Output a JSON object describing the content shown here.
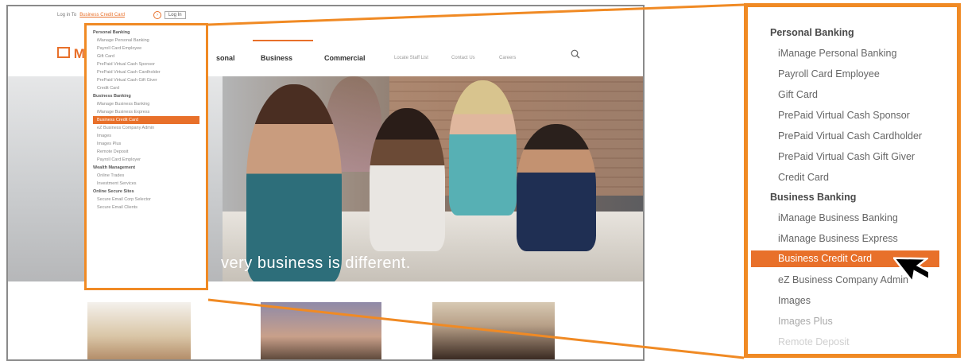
{
  "site": {
    "topbar": {
      "prefix": "Log in To",
      "link": "Business Credit Card",
      "login_button": "Log In"
    },
    "logo_text": "M",
    "nav": {
      "personal_fragment": "sonal",
      "business": "Business",
      "commercial": "Commercial",
      "sub1": "Locate Staff List",
      "sub2": "Contact Us",
      "sub3": "Careers"
    },
    "hero_text": "very business is different.",
    "dropdown": [
      {
        "type": "head",
        "label": "Personal Banking"
      },
      {
        "type": "item",
        "label": "iManage Personal Banking"
      },
      {
        "type": "item",
        "label": "Payroll Card Employee"
      },
      {
        "type": "item",
        "label": "Gift Card"
      },
      {
        "type": "item",
        "label": "PrePaid Virtual Cash Sponsor"
      },
      {
        "type": "item",
        "label": "PrePaid Virtual Cash Cardholder"
      },
      {
        "type": "item",
        "label": "PrePaid Virtual Cash Gift Giver"
      },
      {
        "type": "item",
        "label": "Credit Card"
      },
      {
        "type": "head",
        "label": "Business Banking"
      },
      {
        "type": "item",
        "label": "iManage Business Banking"
      },
      {
        "type": "item",
        "label": "iManage Business Express"
      },
      {
        "type": "active",
        "label": "Business Credit Card"
      },
      {
        "type": "item",
        "label": "eZ Business Company Admin"
      },
      {
        "type": "item",
        "label": "Images"
      },
      {
        "type": "item",
        "label": "Images Plus"
      },
      {
        "type": "item",
        "label": "Remote Deposit"
      },
      {
        "type": "item",
        "label": "Payroll Card Employer"
      },
      {
        "type": "head",
        "label": "Wealth Management"
      },
      {
        "type": "item",
        "label": "Online Trades"
      },
      {
        "type": "item",
        "label": "Investment Services"
      },
      {
        "type": "head",
        "label": "Online Secure Sites"
      },
      {
        "type": "item",
        "label": "Secure Email Corp Selector"
      },
      {
        "type": "item",
        "label": "Secure Email Clients"
      }
    ]
  },
  "zoom": {
    "items": [
      {
        "type": "head",
        "label": "Personal Banking"
      },
      {
        "type": "item",
        "label": "iManage Personal Banking"
      },
      {
        "type": "item",
        "label": "Payroll Card Employee"
      },
      {
        "type": "item",
        "label": "Gift Card"
      },
      {
        "type": "item",
        "label": "PrePaid Virtual Cash Sponsor"
      },
      {
        "type": "item",
        "label": "PrePaid Virtual Cash Cardholder"
      },
      {
        "type": "item",
        "label": "PrePaid Virtual Cash Gift Giver"
      },
      {
        "type": "item",
        "label": "Credit Card"
      },
      {
        "type": "head",
        "label": "Business Banking"
      },
      {
        "type": "item",
        "label": "iManage Business Banking"
      },
      {
        "type": "item",
        "label": "iManage Business Express"
      },
      {
        "type": "active",
        "label": "Business Credit Card"
      },
      {
        "type": "item",
        "label": "eZ Business Company Admin"
      },
      {
        "type": "item",
        "label": "Images"
      },
      {
        "type": "faded",
        "label": "Images Plus"
      },
      {
        "type": "faded2",
        "label": "Remote Deposit"
      }
    ]
  },
  "colors": {
    "accent": "#e8702a",
    "frame": "#f08a24"
  }
}
